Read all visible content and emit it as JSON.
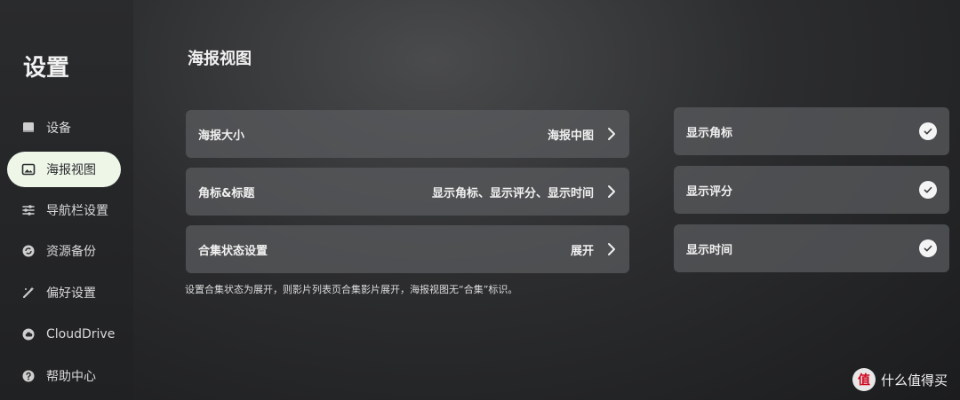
{
  "sidebar": {
    "title": "设置",
    "items": [
      {
        "label": "设备",
        "icon": "device-icon"
      },
      {
        "label": "海报视图",
        "icon": "image-icon",
        "active": true
      },
      {
        "label": "导航栏设置",
        "icon": "sliders-icon"
      },
      {
        "label": "资源备份",
        "icon": "backup-icon"
      },
      {
        "label": "偏好设置",
        "icon": "magic-wand-icon"
      },
      {
        "label": "CloudDrive",
        "icon": "cloud-drive-icon"
      },
      {
        "label": "帮助中心",
        "icon": "help-icon"
      }
    ]
  },
  "main": {
    "title": "海报视图",
    "rows": [
      {
        "label": "海报大小",
        "value": "海报中图"
      },
      {
        "label": "角标&标题",
        "value": "显示角标、显示评分、显示时间"
      },
      {
        "label": "合集状态设置",
        "value": "展开"
      }
    ],
    "hint": "设置合集状态为展开，则影片列表页合集影片展开，海报视图无“合集”标识。"
  },
  "options": {
    "items": [
      {
        "label": "显示角标",
        "checked": true
      },
      {
        "label": "显示评分",
        "checked": true
      },
      {
        "label": "显示时间",
        "checked": true
      }
    ]
  },
  "watermark": {
    "badge": "值",
    "text": "什么值得买"
  },
  "colors": {
    "active_bg": "#eef6e8",
    "row_bg": "#5a5b5e"
  }
}
